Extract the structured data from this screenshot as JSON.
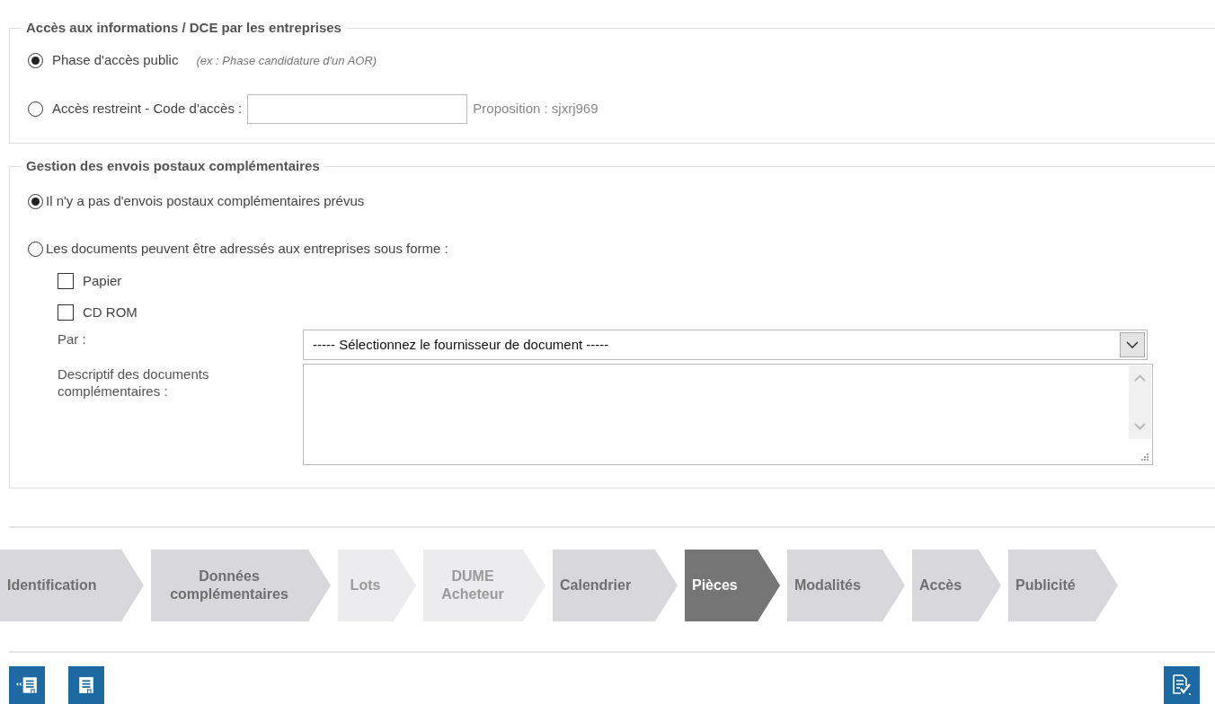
{
  "access_section": {
    "legend": "Accès aux informations / DCE par les entreprises",
    "options": [
      {
        "label": "Phase d'accès public",
        "hint": "(ex : Phase candidature d'un AOR)",
        "selected": true
      },
      {
        "label": "Accès restreint - Code d'accès :",
        "code_field": true,
        "proposal": "Proposition : sjxrj969",
        "selected": false
      }
    ]
  },
  "postal_section": {
    "legend": "Gestion des envois postaux complémentaires",
    "options": [
      {
        "label": "Il n'y a pas d'envois postaux complémentaires prévus",
        "selected": true
      },
      {
        "label": "Les documents peuvent être adressés aux entreprises sous forme :",
        "selected": false
      }
    ],
    "formats": [
      {
        "label": "Papier",
        "checked": false
      },
      {
        "label": "CD ROM",
        "checked": false
      }
    ],
    "provider": {
      "label": "Par :",
      "value": "----- Sélectionnez le fournisseur de document -----"
    },
    "description": {
      "label": "Descriptif des documents complémentaires :"
    }
  },
  "steps": [
    {
      "label": "Identification",
      "selected": false,
      "disabled": false
    },
    {
      "label": "Données complémentaires",
      "selected": false,
      "disabled": false
    },
    {
      "label": "Lots",
      "selected": false,
      "disabled": true
    },
    {
      "label": "DUME Acheteur",
      "selected": false,
      "disabled": true
    },
    {
      "label": "Calendrier",
      "selected": false,
      "disabled": false
    },
    {
      "label": "Pièces",
      "selected": true,
      "disabled": false
    },
    {
      "label": "Modalités",
      "selected": false,
      "disabled": false
    },
    {
      "label": "Accès",
      "selected": false,
      "disabled": false
    },
    {
      "label": "Publicité",
      "selected": false,
      "disabled": false
    }
  ]
}
